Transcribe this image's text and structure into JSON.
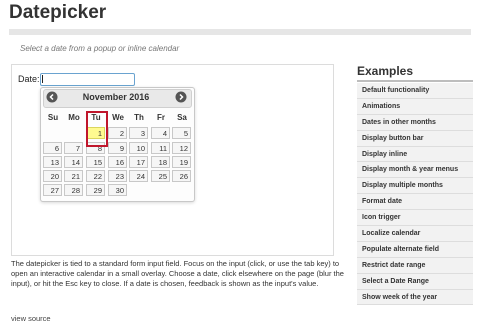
{
  "page": {
    "title": "Datepicker",
    "subtitle": "Select a date from a popup or inline calendar"
  },
  "demo": {
    "date_label": "Date:",
    "input_value": ""
  },
  "calendar": {
    "month_label": "November 2016",
    "prev_icon": "prev-arrow",
    "next_icon": "next-arrow",
    "weekdays": [
      "Su",
      "Mo",
      "Tu",
      "We",
      "Th",
      "Fr",
      "Sa"
    ],
    "weeks": [
      [
        "",
        "",
        "1",
        "2",
        "3",
        "4",
        "5"
      ],
      [
        "6",
        "7",
        "8",
        "9",
        "10",
        "11",
        "12"
      ],
      [
        "13",
        "14",
        "15",
        "16",
        "17",
        "18",
        "19"
      ],
      [
        "20",
        "21",
        "22",
        "23",
        "24",
        "25",
        "26"
      ],
      [
        "27",
        "28",
        "29",
        "30",
        "",
        "",
        ""
      ]
    ],
    "today": "1",
    "today_color": "#fffa90",
    "highlight_color": "#c0162b"
  },
  "description": "The datepicker is tied to a standard form input field. Focus on the input (click, or use the tab key) to open an interactive calendar in a small overlay. Choose a date, click elsewhere on the page (blur the input), or hit the Esc key to close. If a date is chosen, feedback is shown as the input's value.",
  "view_source": "view source",
  "examples": {
    "title": "Examples",
    "items": [
      "Default functionality",
      "Animations",
      "Dates in other months",
      "Display button bar",
      "Display inline",
      "Display month & year menus",
      "Display multiple months",
      "Format date",
      "Icon trigger",
      "Localize calendar",
      "Populate alternate field",
      "Restrict date range",
      "Select a Date Range",
      "Show week of the year"
    ]
  }
}
